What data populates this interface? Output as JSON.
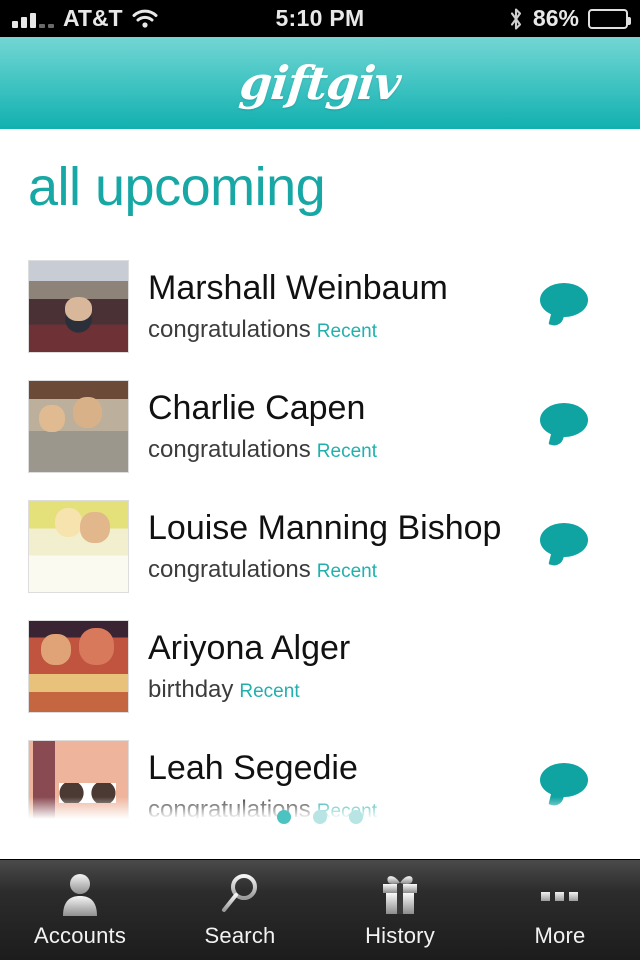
{
  "status_bar": {
    "carrier": "AT&T",
    "time": "5:10 PM",
    "battery_percent": "86%",
    "signal_bars_filled": 3,
    "signal_bars_total": 5,
    "wifi_icon": "wifi-icon",
    "bluetooth_icon": "bluetooth-icon",
    "battery_icon": "battery-icon"
  },
  "header": {
    "brand": "giftgiv",
    "gradient_top": "#74d6d3",
    "gradient_bottom": "#12b0b0"
  },
  "page": {
    "title": "all upcoming",
    "title_color": "#17a7a4",
    "accent_color": "#0fa3a1"
  },
  "list": {
    "items": [
      {
        "name": "Marshall Weinbaum",
        "occasion": "congratulations",
        "tag": "Recent",
        "avatar": "avatar-marshall-weinbaum",
        "has_message": true
      },
      {
        "name": "Charlie Capen",
        "occasion": "congratulations",
        "tag": "Recent",
        "avatar": "avatar-charlie-capen",
        "has_message": true
      },
      {
        "name": "Louise Manning Bishop",
        "occasion": "congratulations",
        "tag": "Recent",
        "avatar": "avatar-louise-manning-bishop",
        "has_message": true
      },
      {
        "name": "Ariyona Alger",
        "occasion": "birthday",
        "tag": "Recent",
        "avatar": "avatar-ariyona-alger",
        "has_message": false
      },
      {
        "name": "Leah Segedie",
        "occasion": "congratulations",
        "tag": "Recent",
        "avatar": "avatar-leah-segedie",
        "has_message": true
      }
    ]
  },
  "pager": {
    "total": 3,
    "active_index": 0
  },
  "tab_bar": {
    "tabs": [
      {
        "label": "Accounts",
        "icon": "person-icon"
      },
      {
        "label": "Search",
        "icon": "search-icon"
      },
      {
        "label": "History",
        "icon": "gift-icon"
      },
      {
        "label": "More",
        "icon": "ellipsis-icon"
      }
    ]
  }
}
